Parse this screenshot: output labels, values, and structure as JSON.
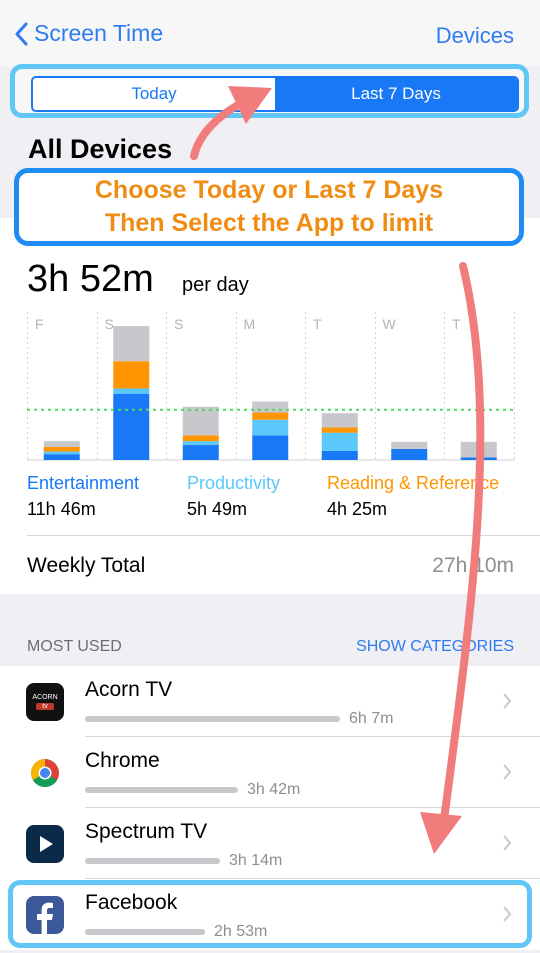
{
  "nav": {
    "back_label": "Screen Time",
    "right_label": "Devices"
  },
  "segment": {
    "today": "Today",
    "last7": "Last 7 Days",
    "selected": "Last 7 Days"
  },
  "section_title": "All Devices",
  "callout": {
    "line1": "Choose Today or Last 7 Days",
    "line2": "Then Select the App to limit"
  },
  "summary": {
    "time": "3h 52m",
    "unit": "per day"
  },
  "chart_data": {
    "type": "bar",
    "stacked": true,
    "categories": [
      "F",
      "S",
      "S",
      "M",
      "T",
      "W",
      "T"
    ],
    "units": "hours",
    "ylim": [
      0,
      10
    ],
    "average_line": 3.87,
    "average_line_color": "#4cd964",
    "series": [
      {
        "name": "Entertainment",
        "color": "#1978f5",
        "values": [
          0.45,
          5.1,
          1.15,
          1.9,
          0.7,
          0.85,
          0.2
        ]
      },
      {
        "name": "Productivity",
        "color": "#5ac8fa",
        "values": [
          0.2,
          0.4,
          0.3,
          1.2,
          1.4,
          0.0,
          0.0
        ]
      },
      {
        "name": "Reading & Reference",
        "color": "#ff9500",
        "values": [
          0.35,
          2.1,
          0.45,
          0.55,
          0.4,
          0.0,
          0.0
        ]
      },
      {
        "name": "Other",
        "color": "#c7c7cc",
        "values": [
          0.45,
          2.7,
          2.2,
          0.85,
          1.1,
          0.55,
          1.2
        ]
      }
    ]
  },
  "categories": [
    {
      "name": "Entertainment",
      "value": "11h 46m",
      "color": "#1978f5"
    },
    {
      "name": "Productivity",
      "value": "5h 49m",
      "color": "#5ac8fa"
    },
    {
      "name": "Reading & Reference",
      "value": "4h 25m",
      "color": "#ff9500"
    }
  ],
  "weekly": {
    "label": "Weekly Total",
    "value": "27h 10m"
  },
  "most_used": {
    "header": "MOST USED",
    "action": "SHOW CATEGORIES"
  },
  "apps": [
    {
      "name": "Acorn TV",
      "duration": "6h 7m",
      "fraction": 1.0,
      "icon": "acorn-tv-icon"
    },
    {
      "name": "Chrome",
      "duration": "3h 42m",
      "fraction": 0.6,
      "icon": "chrome-icon"
    },
    {
      "name": "Spectrum TV",
      "duration": "3h 14m",
      "fraction": 0.53,
      "icon": "spectrum-tv-icon"
    },
    {
      "name": "Facebook",
      "duration": "2h 53m",
      "fraction": 0.47,
      "icon": "facebook-icon"
    }
  ],
  "icon_labels": {
    "acorn_top": "ACORN",
    "acorn_bottom": "tv"
  },
  "colors": {
    "accent": "#1978f5",
    "annotation_frame": "#5fc6f5",
    "annotation_text": "#f08c14",
    "annotation_arrow": "#f07c7c"
  }
}
